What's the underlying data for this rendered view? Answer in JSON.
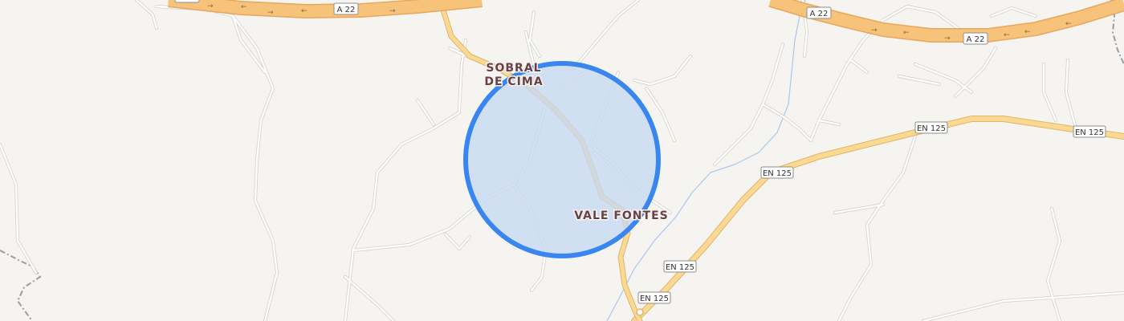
{
  "map": {
    "places": [
      {
        "line1": "SOBRAL",
        "line2": "DE CIMA"
      },
      {
        "line1": "VALE FONTES"
      }
    ],
    "roads": {
      "motorway": "A 22",
      "national": "EN 125"
    },
    "colors": {
      "background": "#f6f4f0",
      "motorway": "#f7c27a",
      "national": "#fbd993",
      "minor_road": "#ffffff",
      "river": "#a8c8ec",
      "boundary": "#9a9aab",
      "accuracy_fill": "#c7d8f2",
      "accuracy_stroke": "#3a86f0"
    },
    "icons": [
      "location-accuracy-circle",
      "roundabout-icon"
    ]
  }
}
